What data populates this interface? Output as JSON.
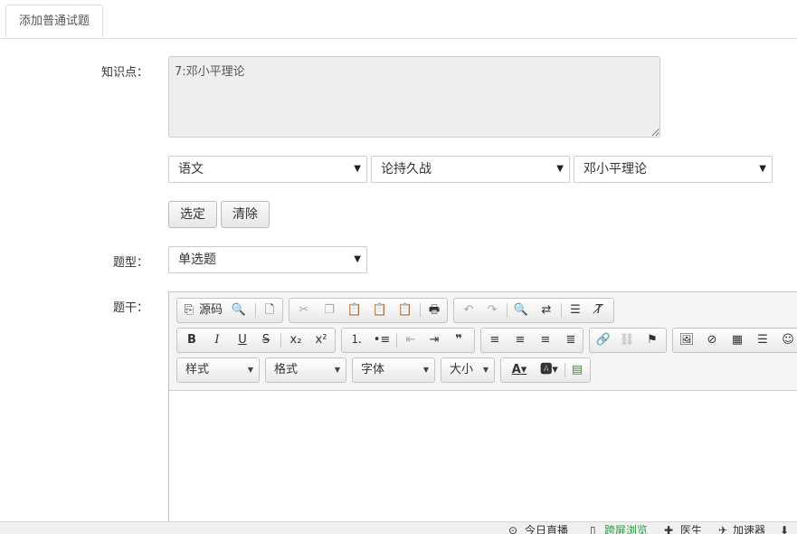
{
  "tab": {
    "label": "添加普通试题"
  },
  "form": {
    "knowledge_label": "知识点：",
    "knowledge_value": "7:邓小平理论",
    "subject_select": "语文",
    "chapter_select": "论持久战",
    "point_select": "邓小平理论",
    "select_button": "选定",
    "clear_button": "清除",
    "type_label": "题型：",
    "type_select": "单选题",
    "stem_label": "题干："
  },
  "editor": {
    "source_label": "源码",
    "style_combo": "样式",
    "format_combo": "格式",
    "font_combo": "字体",
    "size_combo": "大小"
  },
  "statusbar": {
    "item1": "今日直播",
    "item2": "跨屏浏览",
    "item3": "医生",
    "item4": "加速器"
  }
}
